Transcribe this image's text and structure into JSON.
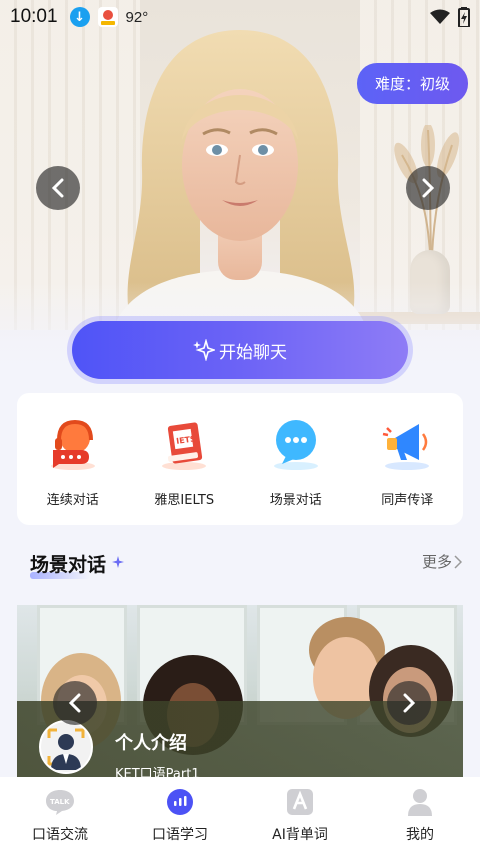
{
  "status_bar": {
    "time": "10:01",
    "temperature": "92°"
  },
  "hero": {
    "difficulty_label": "难度：初级",
    "start_chat_label": "开始聊天"
  },
  "features": [
    {
      "label": "连续对话",
      "icon": "headset-chat-icon"
    },
    {
      "label": "雅思IELTS",
      "icon": "ielts-book-icon"
    },
    {
      "label": "场景对话",
      "icon": "speech-bubble-icon"
    },
    {
      "label": "同声传译",
      "icon": "megaphone-icon"
    }
  ],
  "ielts_book_text": "IETS",
  "section": {
    "title": "场景对话",
    "more_label": "更多"
  },
  "scene_card": {
    "title": "个人介绍",
    "subtitle": "KET口语Part1"
  },
  "bottom_nav": [
    {
      "label": "口语交流",
      "icon": "talk-bubble-icon",
      "active": false
    },
    {
      "label": "口语学习",
      "icon": "voice-wave-icon",
      "active": true
    },
    {
      "label": "AI背单词",
      "icon": "letter-a-icon",
      "active": false
    },
    {
      "label": "我的",
      "icon": "person-icon",
      "active": false
    }
  ],
  "colors": {
    "accent": "#5a5ff6",
    "background": "#f3f4fb"
  }
}
